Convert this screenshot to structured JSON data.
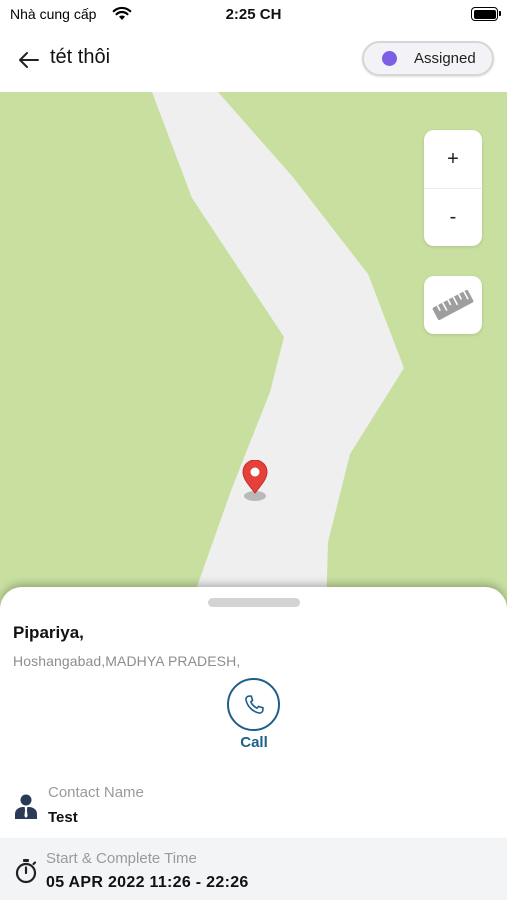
{
  "status_bar": {
    "carrier": "Nhà cung cấp",
    "time": "2:25 CH",
    "wifi_icon": "wifi-icon",
    "battery_icon": "battery-icon"
  },
  "header": {
    "back_icon": "arrow-left-icon",
    "title": "tét thôi",
    "status_label": "Assigned",
    "status_color": "#7b5fe6"
  },
  "map": {
    "land_color": "#c8df9f",
    "road_color": "#efefef",
    "zoom_in_label": "+",
    "zoom_out_label": "-",
    "ruler_icon": "ruler-icon",
    "pin_icon": "map-pin-icon",
    "pin_color": "#e5403a"
  },
  "details": {
    "place_name": "Pipariya,",
    "place_address": "Hoshangabad,MADHYA PRADESH,",
    "call_icon": "phone-icon",
    "call_label": "Call",
    "accent_color": "#1e5f8a",
    "contact": {
      "icon": "person-icon",
      "label": "Contact Name",
      "value": "Test"
    },
    "time": {
      "icon": "stopwatch-icon",
      "label": "Start & Complete Time",
      "value": "05 APR 2022 11:26 - 22:26"
    }
  }
}
